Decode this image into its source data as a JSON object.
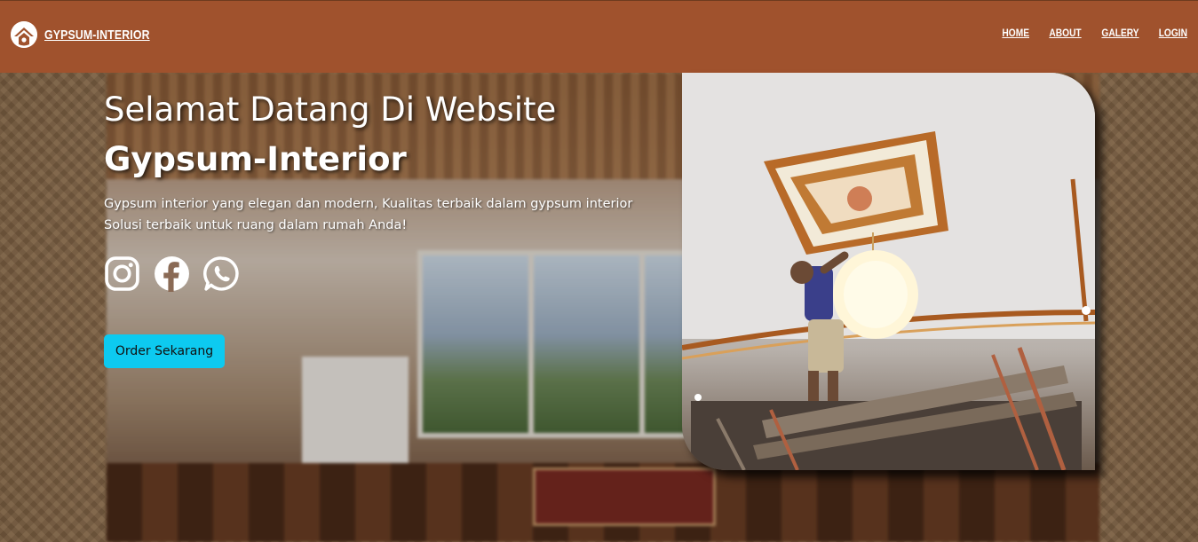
{
  "brand": {
    "name": "GYPSUM-INTERIOR",
    "logo_icon": "house-circle-icon"
  },
  "nav": {
    "items": [
      {
        "label": "HOME"
      },
      {
        "label": "ABOUT"
      },
      {
        "label": "GALERY"
      },
      {
        "label": "LOGIN"
      }
    ]
  },
  "hero": {
    "title_line1": "Selamat Datang Di Website",
    "title_line2": "Gypsum-Interior",
    "subtitle_line1": "Gypsum interior yang elegan dan modern, Kualitas terbaik dalam gypsum interior",
    "subtitle_line2": "Solusi terbaik untuk ruang dalam rumah Anda!",
    "socials": [
      "instagram-icon",
      "facebook-icon",
      "whatsapp-icon"
    ],
    "order_button": "Order Sekarang"
  },
  "colors": {
    "navbar": "#a0522d",
    "button": "#0dcaf0",
    "text": "#ffffff"
  }
}
